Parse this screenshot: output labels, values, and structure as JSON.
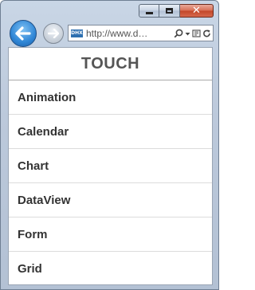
{
  "browser": {
    "address": {
      "url": "http://www.d…",
      "favicon_text": "DHX"
    },
    "icons": [
      "minimize-icon",
      "maximize-icon",
      "close-icon",
      "back-arrow-icon",
      "forward-arrow-icon",
      "search-icon",
      "dropdown-icon",
      "compatibility-icon",
      "refresh-icon"
    ]
  },
  "page": {
    "title": "TOUCH",
    "items": [
      {
        "label": "Animation"
      },
      {
        "label": "Calendar"
      },
      {
        "label": "Chart"
      },
      {
        "label": "DataView"
      },
      {
        "label": "Form"
      },
      {
        "label": "Grid"
      }
    ]
  }
}
